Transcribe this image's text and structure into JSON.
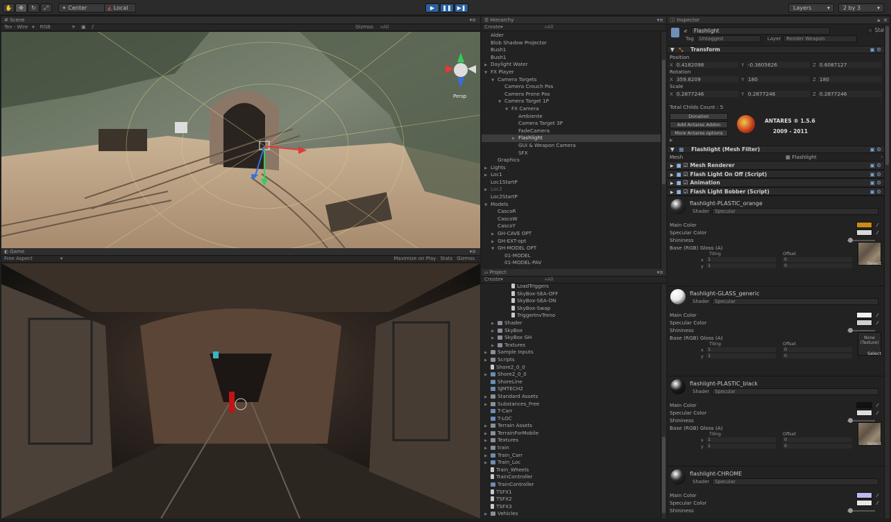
{
  "toolbar": {
    "center_label": "Center",
    "local_label": "Local",
    "layers_label": "Layers",
    "layout_label": "2 by 3"
  },
  "scene": {
    "tab": "Scene",
    "mode": "Tex - Wire",
    "channel": "RGB",
    "gizmos": "Gizmos",
    "search": "All",
    "persp": "Persp"
  },
  "game": {
    "tab": "Game",
    "aspect": "Free Aspect",
    "maximize": "Maximize on Play",
    "stats": "Stats",
    "gizmos": "Gizmos"
  },
  "hierarchy": {
    "tab": "Hierarchy",
    "create": "Create",
    "search": "All",
    "items": [
      {
        "label": "Alder",
        "indent": 0,
        "dim": false
      },
      {
        "label": "Blob Shadow Projector",
        "indent": 0,
        "dim": false
      },
      {
        "label": "Bush1",
        "indent": 0,
        "dim": false
      },
      {
        "label": "Bush1",
        "indent": 0,
        "dim": false
      },
      {
        "label": "Daylight Water",
        "indent": 0,
        "arrow": "▶",
        "dim": false
      },
      {
        "label": "FX Player",
        "indent": 0,
        "arrow": "▼",
        "dim": false
      },
      {
        "label": "Camera Targets",
        "indent": 1,
        "arrow": "▼",
        "dim": false
      },
      {
        "label": "Camera Crouch Pos",
        "indent": 2,
        "dim": false
      },
      {
        "label": "Camera Prone Pos",
        "indent": 2,
        "dim": false
      },
      {
        "label": "Camera Target 1P",
        "indent": 2,
        "arrow": "▼",
        "dim": false
      },
      {
        "label": "FX Camera",
        "indent": 3,
        "arrow": "▼",
        "dim": false
      },
      {
        "label": "Ambiente",
        "indent": 4,
        "dim": false
      },
      {
        "label": "Camera Target 3P",
        "indent": 4,
        "dim": false
      },
      {
        "label": "FadeCamera",
        "indent": 4,
        "dim": false
      },
      {
        "label": "Flashlight",
        "indent": 4,
        "arrow": "▶",
        "dim": false,
        "selected": true
      },
      {
        "label": "GUI & Weapon Camera",
        "indent": 4,
        "dim": false
      },
      {
        "label": "SFX",
        "indent": 4,
        "dim": false
      },
      {
        "label": "Graphics",
        "indent": 1,
        "dim": false
      },
      {
        "label": "Lights",
        "indent": 0,
        "arrow": "▶",
        "dim": false
      },
      {
        "label": "Loc1",
        "indent": 0,
        "arrow": "▶",
        "dim": false
      },
      {
        "label": "Loc1StartP",
        "indent": 0,
        "dim": false
      },
      {
        "label": "Loc2",
        "indent": 0,
        "arrow": "▶",
        "dim": true
      },
      {
        "label": "Loc2StartP",
        "indent": 0,
        "dim": false
      },
      {
        "label": "Models",
        "indent": 0,
        "arrow": "▼",
        "dim": false
      },
      {
        "label": "CascoR",
        "indent": 1,
        "dim": false
      },
      {
        "label": "CascoW",
        "indent": 1,
        "dim": false
      },
      {
        "label": "CascoY",
        "indent": 1,
        "dim": false
      },
      {
        "label": "GH-CAVE OPT",
        "indent": 1,
        "arrow": "▶",
        "dim": false
      },
      {
        "label": "GH-EXT-opt",
        "indent": 1,
        "arrow": "▶",
        "dim": false
      },
      {
        "label": "GH-MODEL OPT",
        "indent": 1,
        "arrow": "▼",
        "dim": false
      },
      {
        "label": "01-MODEL",
        "indent": 2,
        "dim": false
      },
      {
        "label": "01-MODEL-PAV",
        "indent": 2,
        "dim": false
      }
    ]
  },
  "project": {
    "tab": "Project",
    "create": "Create",
    "search": "All",
    "items": [
      {
        "label": "LoadTriggers",
        "indent": 3,
        "icon": "file"
      },
      {
        "label": "SkyBox-SEA-OFF",
        "indent": 3,
        "icon": "file"
      },
      {
        "label": "SkyBox-SEA-ON",
        "indent": 3,
        "icon": "file"
      },
      {
        "label": "SkyBox-Swap",
        "indent": 3,
        "icon": "file"
      },
      {
        "label": "TriggerInvTreno",
        "indent": 3,
        "icon": "file"
      },
      {
        "label": "Shader",
        "indent": 1,
        "icon": "folder",
        "arrow": "▶"
      },
      {
        "label": "SkyBox",
        "indent": 1,
        "icon": "folder",
        "arrow": "▶"
      },
      {
        "label": "SkyBox GH",
        "indent": 1,
        "icon": "folder",
        "arrow": "▶"
      },
      {
        "label": "Textures",
        "indent": 1,
        "icon": "folder",
        "arrow": "▶"
      },
      {
        "label": "Sample Inputs",
        "indent": 0,
        "icon": "folder",
        "arrow": "▶"
      },
      {
        "label": "Scripts",
        "indent": 0,
        "icon": "folder",
        "arrow": "▶"
      },
      {
        "label": "Shore2_0_0",
        "indent": 0,
        "icon": "file"
      },
      {
        "label": "Shore2_0_0",
        "indent": 0,
        "icon": "script",
        "arrow": "▶"
      },
      {
        "label": "ShoreLine",
        "indent": 0,
        "icon": "script"
      },
      {
        "label": "SJMTECH2",
        "indent": 0,
        "icon": "script"
      },
      {
        "label": "Standard Assets",
        "indent": 0,
        "icon": "folder",
        "arrow": "▶"
      },
      {
        "label": "Substances_Free",
        "indent": 0,
        "icon": "folder",
        "arrow": "▶"
      },
      {
        "label": "T-Carr",
        "indent": 0,
        "icon": "script"
      },
      {
        "label": "T-LOC",
        "indent": 0,
        "icon": "script"
      },
      {
        "label": "Terrain Assets",
        "indent": 0,
        "icon": "folder",
        "arrow": "▶"
      },
      {
        "label": "TerrainForMobile",
        "indent": 0,
        "icon": "folder",
        "arrow": "▶"
      },
      {
        "label": "Textures",
        "indent": 0,
        "icon": "folder",
        "arrow": "▶"
      },
      {
        "label": "train",
        "indent": 0,
        "icon": "folder",
        "arrow": "▶"
      },
      {
        "label": "Train_Carr",
        "indent": 0,
        "icon": "script",
        "arrow": "▶"
      },
      {
        "label": "Train_Loc",
        "indent": 0,
        "icon": "script",
        "arrow": "▶"
      },
      {
        "label": "Train_Wheels",
        "indent": 0,
        "icon": "file"
      },
      {
        "label": "TrainController",
        "indent": 0,
        "icon": "file"
      },
      {
        "label": "TrainController",
        "indent": 0,
        "icon": "script"
      },
      {
        "label": "TSFX1",
        "indent": 0,
        "icon": "file"
      },
      {
        "label": "TSFX2",
        "indent": 0,
        "icon": "file"
      },
      {
        "label": "TSFX3",
        "indent": 0,
        "icon": "file"
      },
      {
        "label": "Vehicles",
        "indent": 0,
        "icon": "folder",
        "arrow": "▶"
      }
    ]
  },
  "inspector": {
    "tab": "Inspector",
    "object_name": "Flashlight",
    "static_label": "Static",
    "tag_label": "Tag",
    "tag_value": "Untagged",
    "layer_label": "Layer",
    "layer_value": "Render Weapon",
    "transform": {
      "title": "Transform",
      "position_label": "Position",
      "position": {
        "x": "0.4182098",
        "y": "-0.3605626",
        "z": "0.6087127"
      },
      "rotation_label": "Rotation",
      "rotation": {
        "x": "359.8209",
        "y": "180",
        "z": "180"
      },
      "scale_label": "Scale",
      "scale": {
        "x": "0.2877246",
        "y": "0.2877246",
        "z": "0.2877246"
      },
      "x": "X",
      "y": "Y",
      "z": "Z"
    },
    "childs_count": "Total Childs Count : 5",
    "donation": "Donation",
    "add_addon": "Add Antares Addon",
    "more_options": "More Antares options",
    "antares_title": "ANTARES ® 1.5.6",
    "antares_years": "2009 - 2011",
    "mesh_filter": {
      "title": "Flashlight (Mesh Filter)",
      "mesh_label": "Mesh",
      "mesh_value": "Flashlight"
    },
    "components": [
      "Mesh Renderer",
      "Flash Light On Off (Script)",
      "Animation",
      "Flash Light Bobber (Script)"
    ],
    "shader_label": "Shader",
    "main_color_label": "Main Color",
    "specular_label": "Specular Color",
    "shininess_label": "Shininess",
    "base_label": "Base (RGB) Gloss (A)",
    "tiling_label": "Tiling",
    "offset_label": "Offset",
    "select_label": "Select",
    "none_texture": "None (Texture)",
    "materials": [
      {
        "name": "flashlight-PLASTIC_orange",
        "shader": "Specular",
        "main": "#c98a16",
        "spec": "#d8d8d8",
        "ball": "#2a2a2a",
        "tex": "rock",
        "tx": "1",
        "ty": "1",
        "ox": "0",
        "oy": "0"
      },
      {
        "name": "flashlight-GLASS_generic",
        "shader": "Specular",
        "main": "#f0f0f0",
        "spec": "#cfcfcf",
        "ball": "#e8e8e8",
        "tex": "none",
        "tx": "1",
        "ty": "1",
        "ox": "0",
        "oy": "0"
      },
      {
        "name": "flashlight-PLASTIC_black",
        "shader": "Specular",
        "main": "#111111",
        "spec": "#dcdcdc",
        "ball": "#1a1a1a",
        "tex": "rock",
        "tx": "1",
        "ty": "1",
        "ox": "0",
        "oy": "0"
      },
      {
        "name": "flashlight-CHROME",
        "shader": "Specular",
        "main": "#b9b9f4",
        "spec": "#e6e6e6",
        "ball": "#262626",
        "tex": "none",
        "tx": "",
        "ty": "",
        "ox": "",
        "oy": ""
      }
    ]
  }
}
